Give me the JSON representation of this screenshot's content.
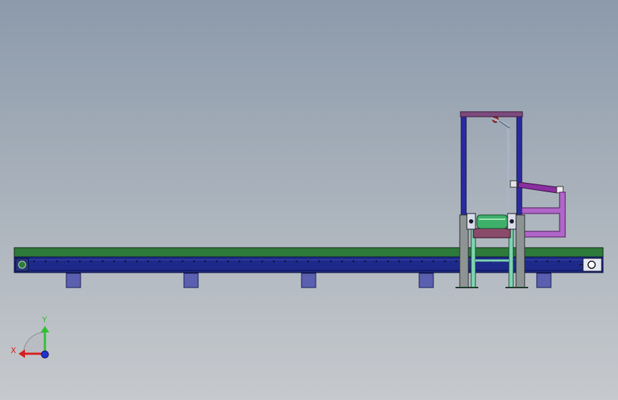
{
  "viewport": {
    "background_top": "#8c9aab",
    "background_bottom": "#c6c9cd"
  },
  "triad": {
    "y_label": "Y",
    "x_label": "X",
    "x_color": "#d61e1e",
    "y_color": "#2fbf2f",
    "z_color": "#2233cc"
  },
  "model": {
    "conveyor_belt_color": "#2e7a3a",
    "conveyor_frame_color": "#1e2a8a",
    "support_foot_color": "#5a5fb0",
    "frame_post_color": "#8e9494",
    "portal_frame_color": "#2a2aa0",
    "top_beam_color": "#7d4a7d",
    "cylinder_color": "#8a2fa0",
    "bracket_color": "#b066c8",
    "roller_color": "#3fb06a"
  }
}
